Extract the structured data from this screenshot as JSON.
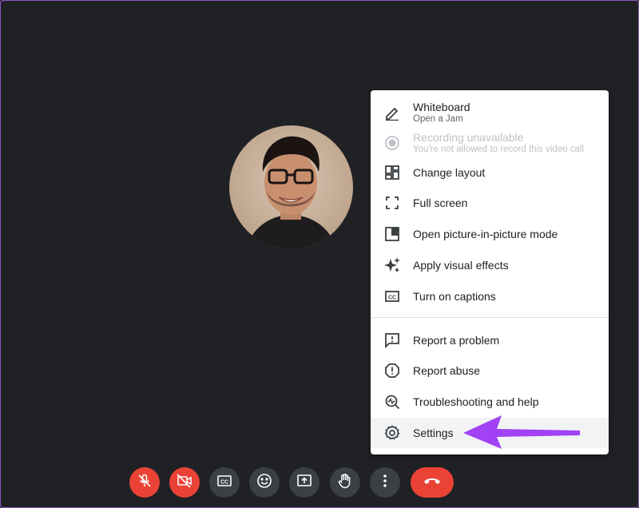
{
  "menu": {
    "items": [
      {
        "label": "Whiteboard",
        "sub": "Open a Jam",
        "icon": "pencil-icon",
        "enabled": true
      },
      {
        "label": "Recording unavailable",
        "sub": "You're not allowed to record this video call",
        "icon": "record-icon",
        "enabled": false
      },
      {
        "label": "Change layout",
        "icon": "layout-icon",
        "enabled": true
      },
      {
        "label": "Full screen",
        "icon": "fullscreen-icon",
        "enabled": true
      },
      {
        "label": "Open picture-in-picture mode",
        "icon": "picture-in-picture-icon",
        "enabled": true
      },
      {
        "label": "Apply visual effects",
        "icon": "sparkle-icon",
        "enabled": true
      },
      {
        "label": "Turn on captions",
        "icon": "captions-icon",
        "enabled": true
      },
      {
        "label": "Report a problem",
        "icon": "feedback-icon",
        "enabled": true
      },
      {
        "label": "Report abuse",
        "icon": "report-icon",
        "enabled": true
      },
      {
        "label": "Troubleshooting and help",
        "icon": "troubleshoot-icon",
        "enabled": true
      },
      {
        "label": "Settings",
        "icon": "gear-icon",
        "enabled": true,
        "highlighted": true
      }
    ]
  },
  "toolbar": {
    "buttons": [
      {
        "name": "microphone-off-button",
        "icon": "mic-off-icon",
        "state": "off"
      },
      {
        "name": "camera-off-button",
        "icon": "camera-off-icon",
        "state": "off"
      },
      {
        "name": "captions-button",
        "icon": "captions-icon"
      },
      {
        "name": "emoji-reaction-button",
        "icon": "emoji-icon"
      },
      {
        "name": "present-screen-button",
        "icon": "present-icon"
      },
      {
        "name": "raise-hand-button",
        "icon": "hand-icon"
      },
      {
        "name": "more-options-button",
        "icon": "more-vert-icon"
      },
      {
        "name": "leave-call-button",
        "icon": "hang-up-icon"
      }
    ]
  },
  "colors": {
    "background": "#202124",
    "danger": "#ea4335",
    "control": "#3c4043",
    "annotation_arrow": "#a142f4"
  }
}
